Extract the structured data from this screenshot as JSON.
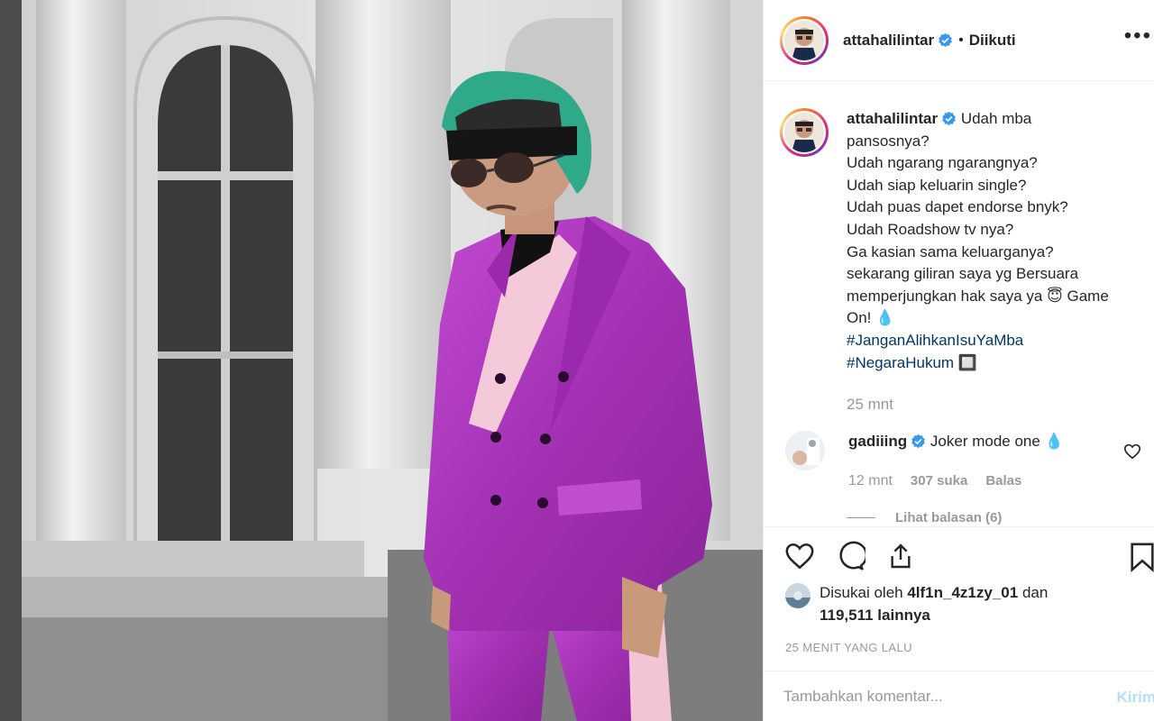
{
  "post": {
    "username": "attahalilintar",
    "follow_status": "Diikuti",
    "separator": "•",
    "more_label": "•••"
  },
  "caption": {
    "lines": [
      "Udah mba",
      "pansosnya?",
      "Udah ngarang ngarangnya?",
      "Udah siap keluarin single?",
      "Udah puas dapet endorse bnyk?",
      "Udah Roadshow tv nya?",
      "Ga kasian sama keluarganya?",
      "sekarang giliran saya yg Bersuara",
      "memperjungkan hak saya ya 😇 Game",
      "On! 💧"
    ],
    "hashtags": [
      "#JanganAlihkanIsuYaMba",
      "#NegaraHukum 🔲"
    ],
    "time": "25 mnt"
  },
  "comment": {
    "username": "gadiiing",
    "text": "Joker mode one 💧",
    "time": "12 mnt",
    "likes": "307 suka",
    "reply_label": "Balas",
    "view_replies": "Lihat balasan (6)"
  },
  "likes": {
    "prefix": "Disukai oleh",
    "user": "4lf1n_4z1zy_01",
    "connector": "dan",
    "count": "119,511 lainnya"
  },
  "posted_ago": "25 MENIT YANG LALU",
  "add_comment": {
    "placeholder": "Tambahkan komentar...",
    "send_label": "Kirim"
  },
  "icons": [
    "heart-icon",
    "comment-icon",
    "share-icon",
    "bookmark-icon",
    "verified-icon",
    "more-icon"
  ],
  "colors": {
    "verified": "#3897f0",
    "hashtag": "#003569",
    "send": "#b2dffc",
    "suit": "#b03ac0"
  }
}
